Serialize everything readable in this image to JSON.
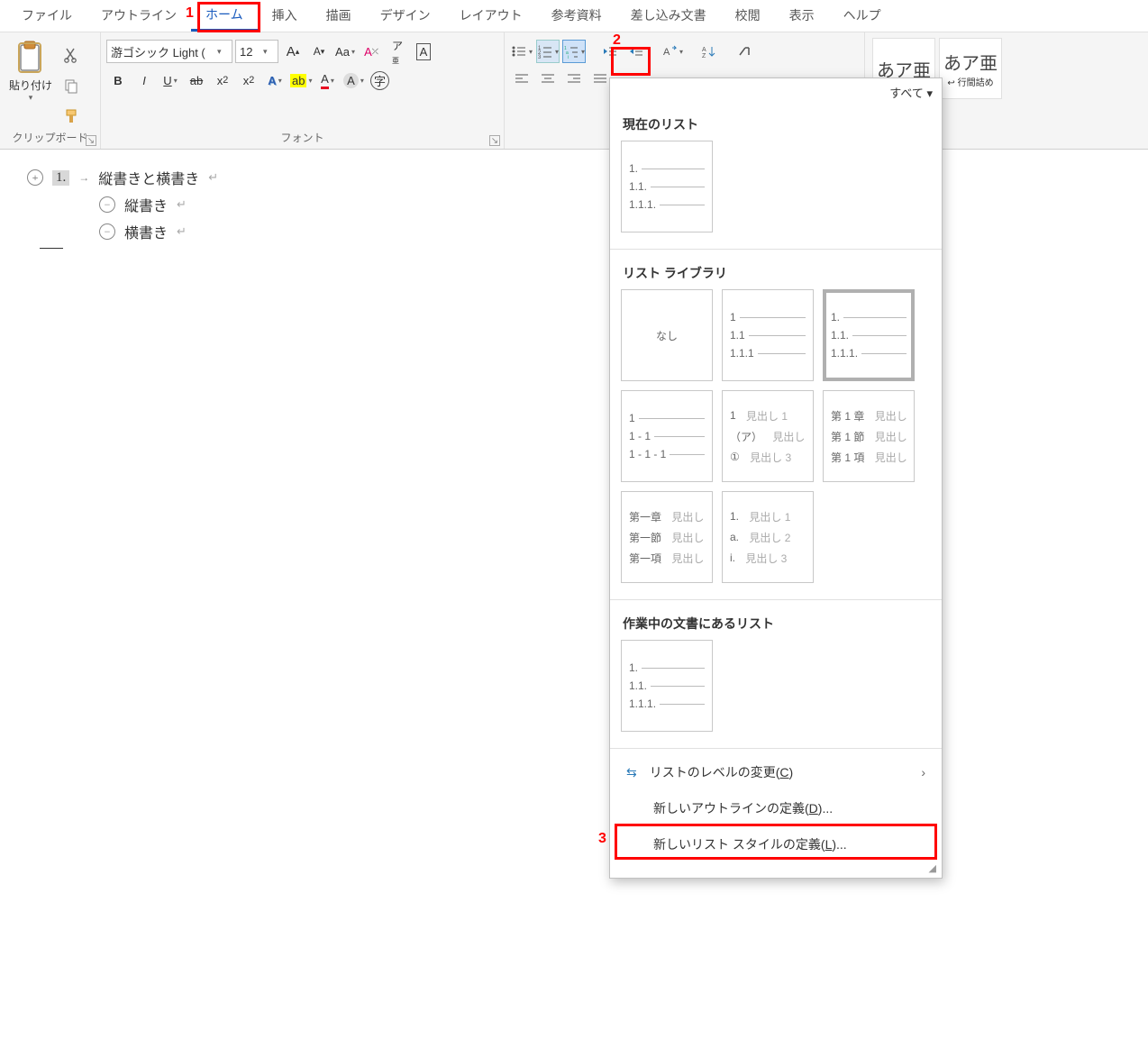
{
  "tabs": [
    "ファイル",
    "アウトライン",
    "ホーム",
    "挿入",
    "描画",
    "デザイン",
    "レイアウト",
    "参考資料",
    "差し込み文書",
    "校閲",
    "表示",
    "ヘルプ"
  ],
  "active_tab_index": 2,
  "ribbon": {
    "clipboard": {
      "paste": "貼り付け",
      "label": "クリップボード"
    },
    "font": {
      "family": "游ゴシック Light (",
      "size": "12",
      "label": "フォント"
    },
    "styles": {
      "sample": "あア亜",
      "caption1": "",
      "caption2": "↩ 行間詰め"
    }
  },
  "annotations": {
    "n1": "1",
    "n2": "2",
    "n3": "3"
  },
  "document": {
    "rows": [
      {
        "level": 0,
        "icon": "plus",
        "num": "1.",
        "text": "縦書きと横書き"
      },
      {
        "level": 1,
        "icon": "minus",
        "text": "縦書き"
      },
      {
        "level": 1,
        "icon": "minus",
        "text": "横書き"
      }
    ]
  },
  "dropdown": {
    "all_label": "すべて ▾",
    "sections": {
      "current": "現在のリスト",
      "library": "リスト ライブラリ",
      "in_doc": "作業中の文書にあるリスト"
    },
    "tiles": {
      "numeric": [
        "1.",
        "1.1.",
        "1.1.1."
      ],
      "none": "なし",
      "lib_b": [
        "1",
        "1.1",
        "1.1.1"
      ],
      "lib_c": [
        "1.",
        "1.1.",
        "1.1.1."
      ],
      "lib_d": [
        "1",
        "1 - 1",
        "1 - 1 - 1"
      ],
      "lib_e": [
        [
          "1",
          "見出し 1"
        ],
        [
          "（ア）",
          "見出し 2"
        ],
        [
          "①",
          "見出し 3"
        ]
      ],
      "lib_f": [
        [
          "第 1 章",
          "見出し"
        ],
        [
          "第 1 節",
          "見出し"
        ],
        [
          "第 1 項",
          "見出し"
        ]
      ],
      "lib_g": [
        [
          "第一章",
          "見出し"
        ],
        [
          "第一節",
          "見出し"
        ],
        [
          "第一項",
          "見出し"
        ]
      ],
      "lib_h": [
        [
          "1.",
          "見出し 1"
        ],
        [
          "a.",
          "見出し 2"
        ],
        [
          "i.",
          "見出し 3"
        ]
      ]
    },
    "menu": {
      "change_level": "リストのレベルの変更",
      "change_level_key": "C",
      "new_outline": "新しいアウトラインの定義",
      "new_outline_key": "D",
      "new_liststyle": "新しいリスト スタイルの定義",
      "new_liststyle_key": "L"
    }
  }
}
